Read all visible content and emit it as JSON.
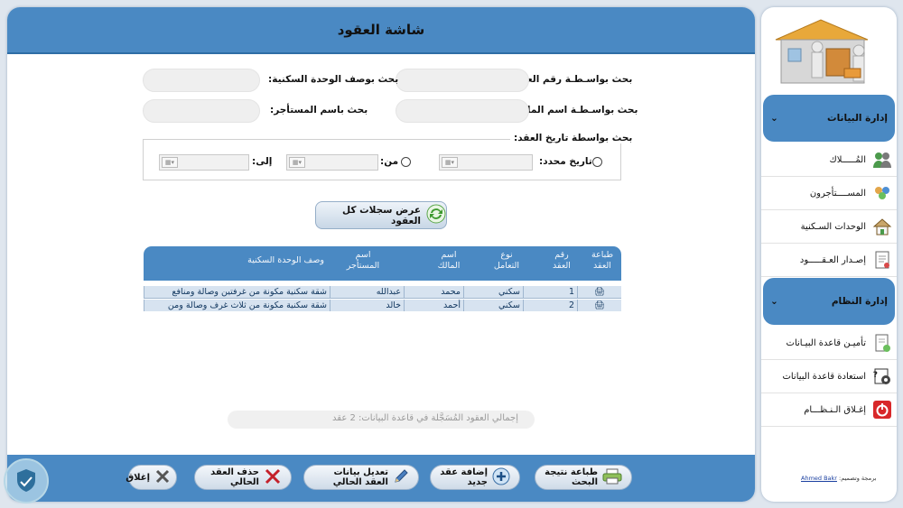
{
  "header": {
    "title": "شاشة العقود"
  },
  "search": {
    "contract_no_label": "بحث بواسـطـة رقم العقد:",
    "unit_desc_label": "بحث بوصف الوحدة السكنية:",
    "owner_label": "بحث بواسـطـة اسم المالك:",
    "tenant_label": "بحث باسم المستأجر:",
    "date_group_label": "بحث بواسطة تاريخ العقد:",
    "specific_date_label": "تاريخ محدد:",
    "from_label": "من:",
    "to_label": "إلى:"
  },
  "show_all_button": "عرض سجلات كل العقود",
  "grid": {
    "columns": [
      "طباعة العقد",
      "رقم العقد",
      "نوع التعامل",
      "اسم المالك",
      "اسم المستأجر",
      "وصف الوحدة السكنية"
    ],
    "rows": [
      {
        "contract_no": "1",
        "type": "سكني",
        "owner": "محمد",
        "tenant": "عبدالله",
        "description": "شقة سكنية مكونة من غرفتين وصالة ومنافع"
      },
      {
        "contract_no": "2",
        "type": "سكني",
        "owner": "أحمد",
        "tenant": "خالد",
        "description": "شقة سكنية مكونة من ثلاث غرف وصالة ومن"
      }
    ]
  },
  "total_label": "إجمالي العقود المُسَجَّلة في قاعدة البيانات: 2 عقد",
  "footer": {
    "print_results": "طباعة نتيجة البحث",
    "add_contract": "إضافة عقد جديد",
    "edit_contract": "تعديل بيانات العقد الحالي",
    "delete_contract": "حذف العقد الحالي",
    "close": "إغلاق"
  },
  "sidebar": {
    "data_section": "إدارة البيانات",
    "owners": "المُـــــلاك",
    "tenants": "المســــتأجرون",
    "units": "الوحدات السـكنية",
    "contracts": "إصـدار العـقـــــود",
    "system_section": "إدارة النظام",
    "backup": "تأميـن قاعدة البيـانات",
    "restore": "استعادة قاعدة البيانات",
    "exit": "إغـلاق الـنـظـــام",
    "credit_prefix": "برمجة وتصميم:",
    "credit_name": "Ahmed Bakr"
  },
  "colors": {
    "accent": "#4a89c3",
    "row": "#d7e3f0",
    "text_dark": "#10365e"
  }
}
